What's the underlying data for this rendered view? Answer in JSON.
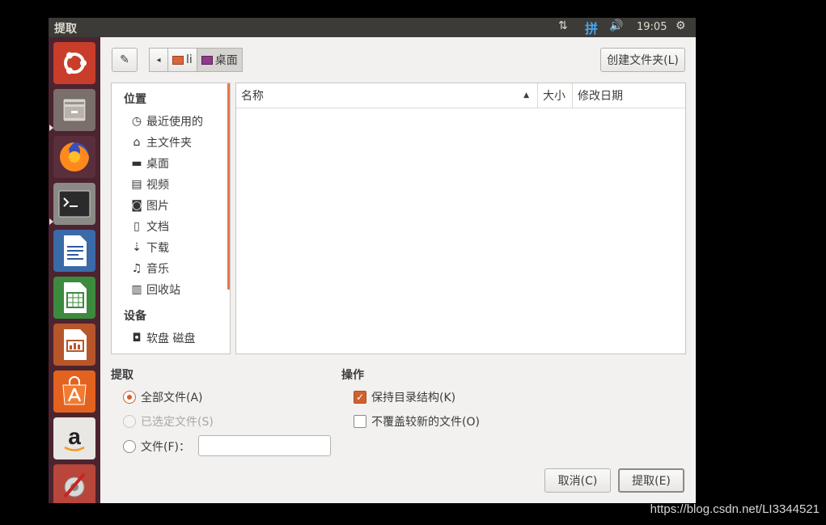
{
  "topbar": {
    "window_title": "提取",
    "ime_label": "拼",
    "clock": "19:05"
  },
  "launcher": {
    "apps": [
      "ubuntu-dash",
      "files",
      "firefox",
      "terminal",
      "libreoffice-writer",
      "libreoffice-calc",
      "libreoffice-impress",
      "ubuntu-software",
      "amazon",
      "system-settings"
    ]
  },
  "toolbar": {
    "path_segments": [
      "li",
      "桌面"
    ],
    "create_folder_label": "创建文件夹(L)"
  },
  "places": {
    "header_places": "位置",
    "items": [
      {
        "label": "最近使用的",
        "icon": "clock-icon"
      },
      {
        "label": "主文件夹",
        "icon": "home-icon"
      },
      {
        "label": "桌面",
        "icon": "folder-icon"
      },
      {
        "label": "视频",
        "icon": "film-icon"
      },
      {
        "label": "图片",
        "icon": "camera-icon"
      },
      {
        "label": "文档",
        "icon": "document-icon"
      },
      {
        "label": "下载",
        "icon": "download-icon"
      },
      {
        "label": "音乐",
        "icon": "music-icon"
      },
      {
        "label": "回收站",
        "icon": "trash-icon"
      }
    ],
    "header_devices": "设备",
    "devices": [
      {
        "label": "软盘 磁盘",
        "icon": "floppy-icon"
      }
    ]
  },
  "filelist": {
    "columns": [
      "名称",
      "大小",
      "修改日期"
    ]
  },
  "extract": {
    "header": "提取",
    "all_files": "全部文件(A)",
    "selected_files": "已选定文件(S)",
    "files_label": "文件(F)：",
    "files_value": ""
  },
  "actions": {
    "header": "操作",
    "keep_structure": "保持目录结构(K)",
    "no_overwrite": "不覆盖较新的文件(O)"
  },
  "buttons": {
    "cancel": "取消(C)",
    "extract": "提取(E)"
  },
  "watermark": "https://blog.csdn.net/LI3344521"
}
